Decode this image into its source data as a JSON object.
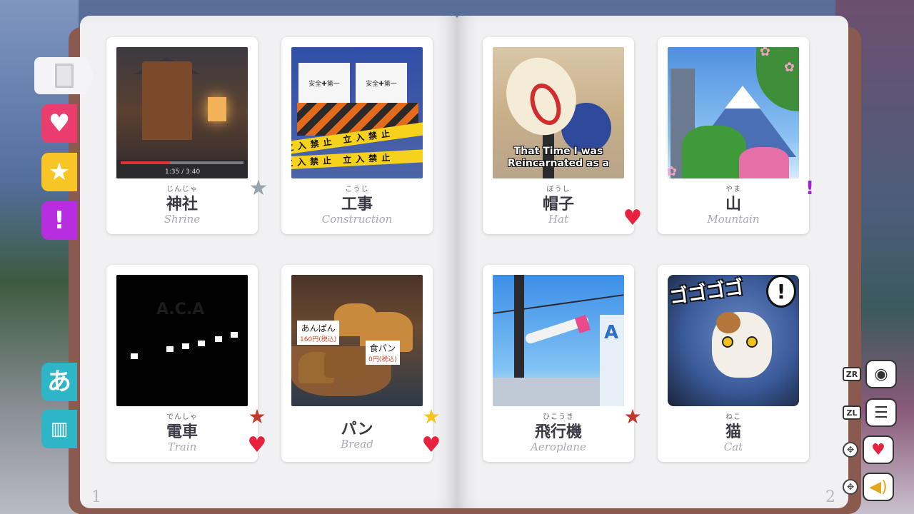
{
  "left_tabs": {
    "hiragana": "あ"
  },
  "cards": [
    {
      "furigana": "じんじゃ",
      "kanji": "神社",
      "english": "Shrine",
      "badges": [
        "star-grey"
      ],
      "video_time": "1:35 / 3:40"
    },
    {
      "furigana": "こうじ",
      "kanji": "工事",
      "english": "Construction",
      "badges": [],
      "signs": [
        "安全✚第一",
        "安全✚第一"
      ],
      "tape": "立入禁止 立入禁止"
    },
    {
      "furigana": "ぼうし",
      "kanji": "帽子",
      "english": "Hat",
      "badges": [
        "heart"
      ],
      "subtitle": "That Time I was Reincarnated as a"
    },
    {
      "furigana": "やま",
      "kanji": "山",
      "english": "Mountain",
      "badges": [
        "exclamation"
      ]
    },
    {
      "furigana": "でんしゃ",
      "kanji": "電車",
      "english": "Train",
      "badges": [
        "star-red",
        "heart"
      ],
      "sign": "A.C.A"
    },
    {
      "furigana": "",
      "kanji": "パン",
      "english": "Bread",
      "badges": [
        "star-yellow",
        "heart"
      ],
      "tags": [
        {
          "name": "あんぱん",
          "price": "160円",
          "tax": "(税込)"
        },
        {
          "name": "食パン",
          "price": "0円",
          "tax": "(税込)"
        }
      ]
    },
    {
      "furigana": "ひこうき",
      "kanji": "飛行機",
      "english": "Aeroplane",
      "badges": [
        "star-red"
      ],
      "building_sign": "A"
    },
    {
      "furigana": "ねこ",
      "kanji": "猫",
      "english": "Cat",
      "badges": [],
      "sfx": "ゴゴゴゴ",
      "bubble": "!"
    }
  ],
  "page_numbers": {
    "left": "1",
    "right": "2"
  },
  "controls": [
    {
      "button": "ZR",
      "icon": "camera-icon"
    },
    {
      "button": "ZL",
      "icon": "notes-icon"
    },
    {
      "button": "",
      "icon": "heart-icon"
    },
    {
      "button": "",
      "icon": "speaker-icon"
    }
  ],
  "colors": {
    "heart": "#e8213f",
    "star_grey": "#98a4ac",
    "star_red": "#c0392b",
    "star_yellow": "#f5c518",
    "exclamation": "#a21fc9",
    "tab_cyan": "#2eb6c8",
    "page": "#f1f0f2"
  }
}
